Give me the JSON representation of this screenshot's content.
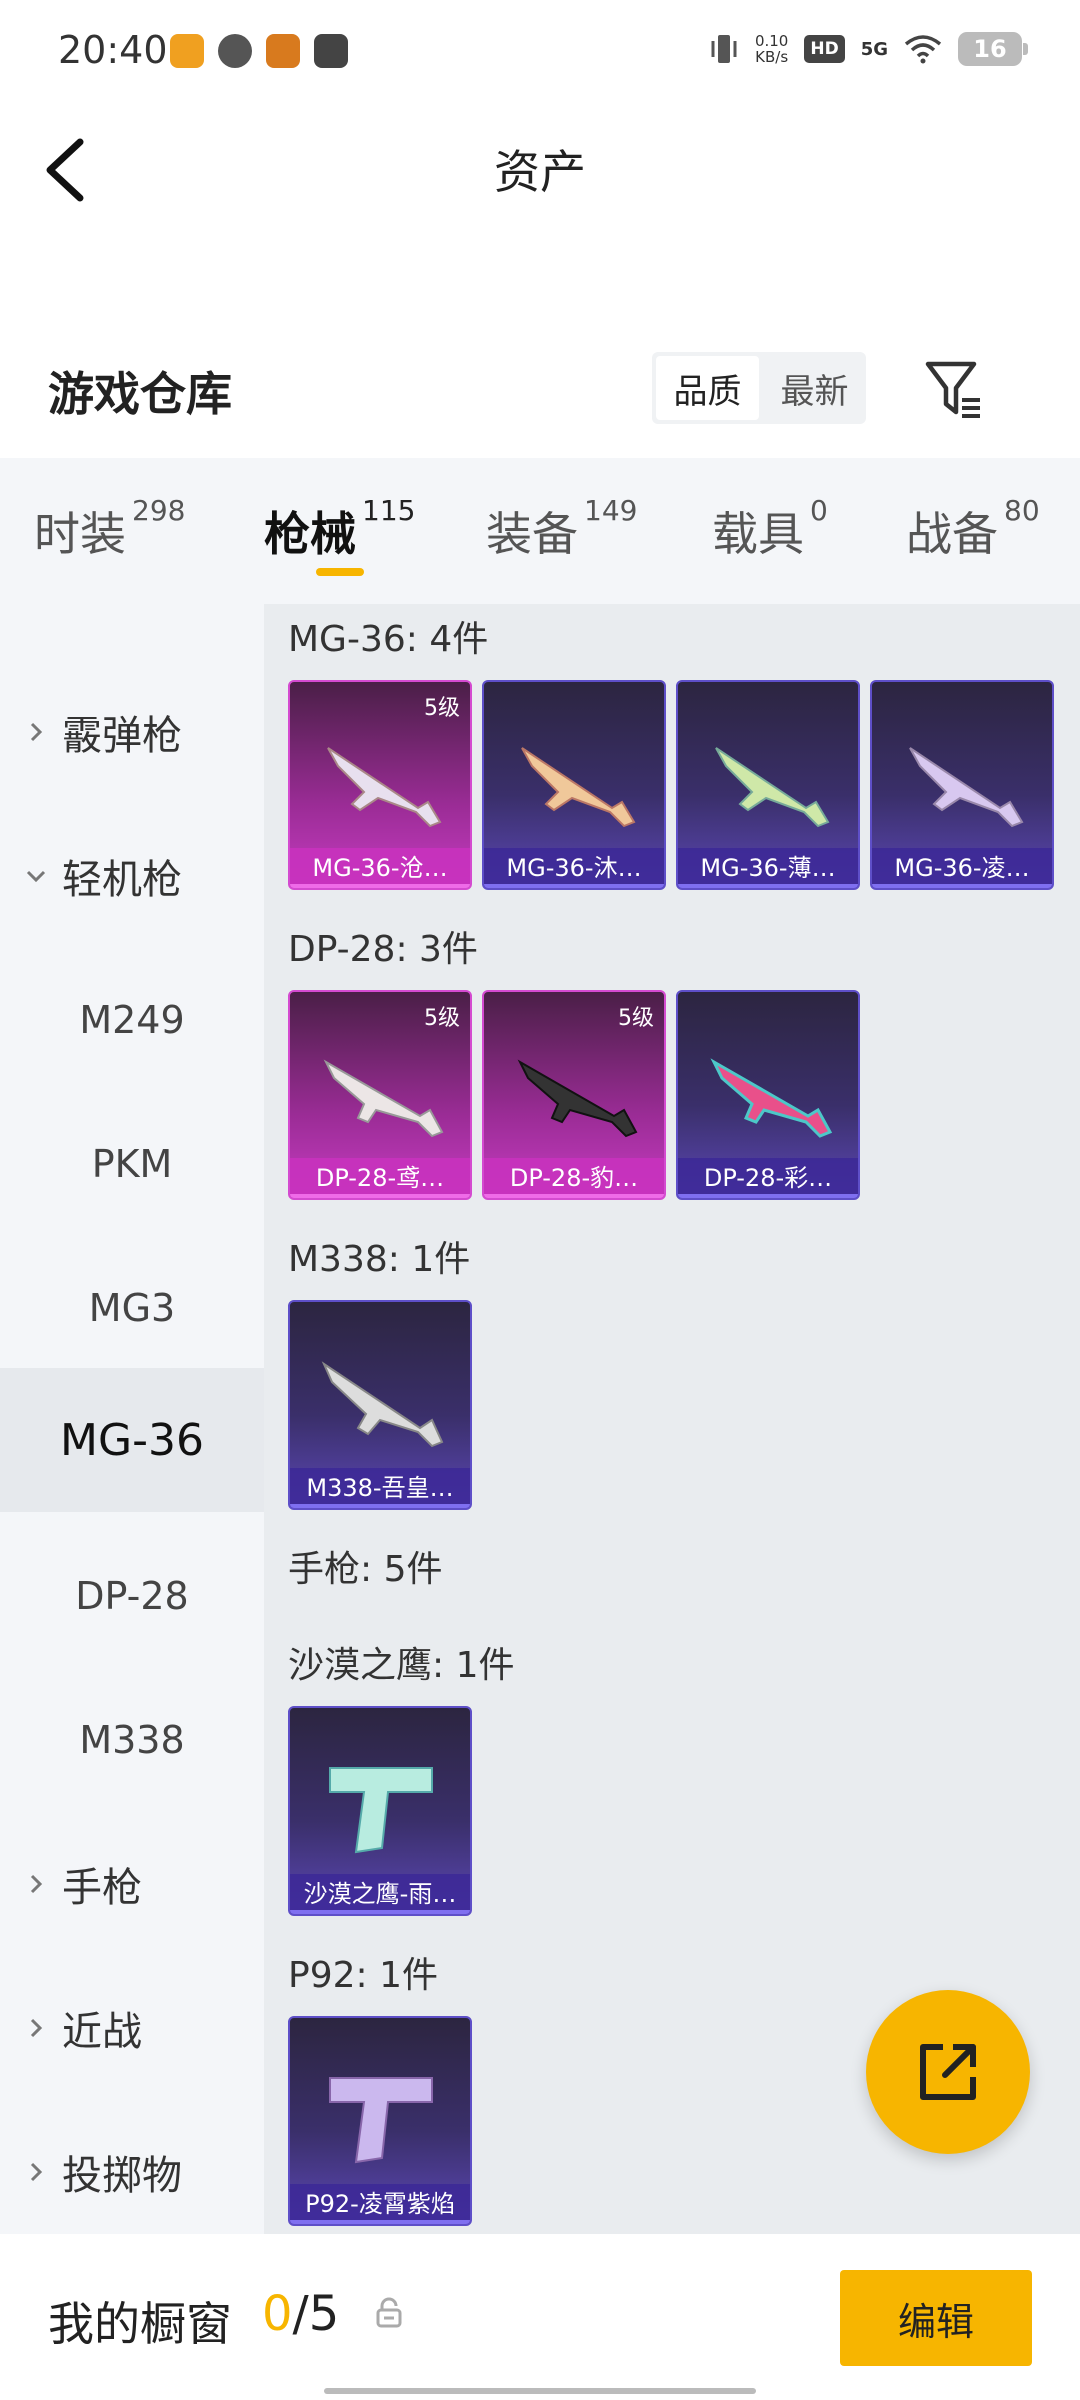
{
  "status_bar": {
    "time": "20:40",
    "net_speed_value": "0.10",
    "net_speed_unit": "KB/s",
    "hd": "HD",
    "signal": "5G",
    "battery": "16"
  },
  "header": {
    "title": "资产"
  },
  "warehouse": {
    "title": "游戏仓库",
    "sort_quality": "品质",
    "sort_newest": "最新"
  },
  "tabs": [
    {
      "label": "时装",
      "count": "298"
    },
    {
      "label": "枪械",
      "count": "115"
    },
    {
      "label": "装备",
      "count": "149"
    },
    {
      "label": "载具",
      "count": "0"
    },
    {
      "label": "战备",
      "count": "80"
    }
  ],
  "sidebar": {
    "items": [
      {
        "label": "霰弹枪"
      },
      {
        "label": "轻机枪"
      },
      {
        "label": "M249"
      },
      {
        "label": "PKM"
      },
      {
        "label": "MG3"
      },
      {
        "label": "MG-36"
      },
      {
        "label": "DP-28"
      },
      {
        "label": "M338"
      },
      {
        "label": "手枪"
      },
      {
        "label": "近战"
      },
      {
        "label": "投掷物"
      }
    ]
  },
  "sections": [
    {
      "title": "MG-36: 4件",
      "items": [
        {
          "name": "MG-36-沧…",
          "level": "5级"
        },
        {
          "name": "MG-36-沐…"
        },
        {
          "name": "MG-36-薄…"
        },
        {
          "name": "MG-36-凌…"
        }
      ]
    },
    {
      "title": "DP-28: 3件",
      "items": [
        {
          "name": "DP-28-鸢…",
          "level": "5级"
        },
        {
          "name": "DP-28-豹…",
          "level": "5级"
        },
        {
          "name": "DP-28-彩…"
        }
      ]
    },
    {
      "title": "M338: 1件",
      "items": [
        {
          "name": "M338-吾皇…"
        }
      ]
    },
    {
      "title": "手枪: 5件"
    },
    {
      "title": "沙漠之鹰: 1件",
      "items": [
        {
          "name": "沙漠之鹰-雨…"
        }
      ]
    },
    {
      "title": "P92: 1件",
      "items": [
        {
          "name": "P92-凌霄紫焰"
        }
      ]
    }
  ],
  "bottom_bar": {
    "label": "我的橱窗",
    "current": "0",
    "total": "/5",
    "edit": "编辑"
  },
  "colors": {
    "accent": "#f7b500",
    "purple_card": "#5e4fc8",
    "pink_card": "#d44bd0"
  },
  "icons": [
    "back-arrow-icon",
    "filter-icon",
    "chevron-right-icon",
    "chevron-down-icon",
    "share-icon",
    "lock-icon"
  ]
}
